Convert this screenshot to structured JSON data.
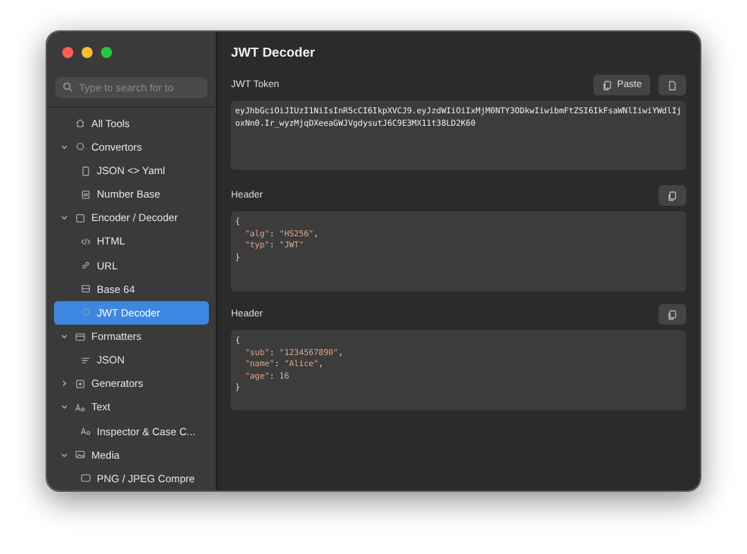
{
  "sidebar": {
    "search": {
      "placeholder": "Type to search for to"
    },
    "items": [
      {
        "label": "All Tools",
        "selected": false
      },
      {
        "label": "Convertors",
        "expanded": true,
        "selected": false,
        "children": [
          {
            "label": "JSON <> Yaml",
            "selected": false
          },
          {
            "label": "Number Base",
            "selected": false
          }
        ]
      },
      {
        "label": "Encoder / Decoder",
        "expanded": true,
        "selected": false,
        "children": [
          {
            "label": "HTML",
            "selected": false
          },
          {
            "label": "URL",
            "selected": false
          },
          {
            "label": "Base 64",
            "selected": false
          },
          {
            "label": "JWT Decoder",
            "selected": true
          }
        ]
      },
      {
        "label": "Formatters",
        "expanded": true,
        "selected": false,
        "children": [
          {
            "label": "JSON",
            "selected": false
          }
        ]
      },
      {
        "label": "Generators",
        "expanded": false,
        "selected": false
      },
      {
        "label": "Text",
        "expanded": true,
        "selected": false,
        "children": [
          {
            "label": "Inspector & Case C...",
            "selected": false
          }
        ]
      },
      {
        "label": "Media",
        "expanded": true,
        "selected": false,
        "children": [
          {
            "label": "PNG / JPEG Compre",
            "selected": false
          }
        ]
      }
    ]
  },
  "main": {
    "title": "JWT Decoder",
    "token": {
      "label": "JWT Token",
      "paste_button": "Paste",
      "value": "eyJhbGciOiJIUzI1NiIsInR5cCI6IkpXVCJ9.eyJzdWIiOiIxMjM0NTY3ODkwIiwibmFtZSI6IkFsaWNlIiwiYWdlIjoxNn0.Ir_wyzMjqDXeeaGWJVgdysutJ6C9E3MX11t38LD2K60"
    },
    "sections": [
      {
        "label": "Header",
        "lines": [
          [
            {
              "kind": "punct",
              "text": "{"
            }
          ],
          [
            {
              "kind": "key",
              "text": "\"alg\""
            },
            {
              "kind": "punct",
              "text": ": "
            },
            {
              "kind": "string",
              "text": "\"HS256\""
            },
            {
              "kind": "punct",
              "text": ","
            }
          ],
          [
            {
              "kind": "key",
              "text": "\"typ\""
            },
            {
              "kind": "punct",
              "text": ": "
            },
            {
              "kind": "string",
              "text": "\"JWT\""
            }
          ],
          [
            {
              "kind": "punct",
              "text": "}"
            }
          ]
        ]
      },
      {
        "label": "Header",
        "lines": [
          [
            {
              "kind": "punct",
              "text": "{"
            }
          ],
          [
            {
              "kind": "key",
              "text": "\"sub\""
            },
            {
              "kind": "punct",
              "text": ": "
            },
            {
              "kind": "string",
              "text": "\"1234567890\""
            },
            {
              "kind": "punct",
              "text": ","
            }
          ],
          [
            {
              "kind": "key",
              "text": "\"name\""
            },
            {
              "kind": "punct",
              "text": ": "
            },
            {
              "kind": "string",
              "text": "\"Alice\""
            },
            {
              "kind": "punct",
              "text": ","
            }
          ],
          [
            {
              "kind": "key",
              "text": "\"age\""
            },
            {
              "kind": "punct",
              "text": ": "
            },
            {
              "kind": "number",
              "text": "16"
            }
          ],
          [
            {
              "kind": "punct",
              "text": "}"
            }
          ]
        ]
      }
    ]
  }
}
